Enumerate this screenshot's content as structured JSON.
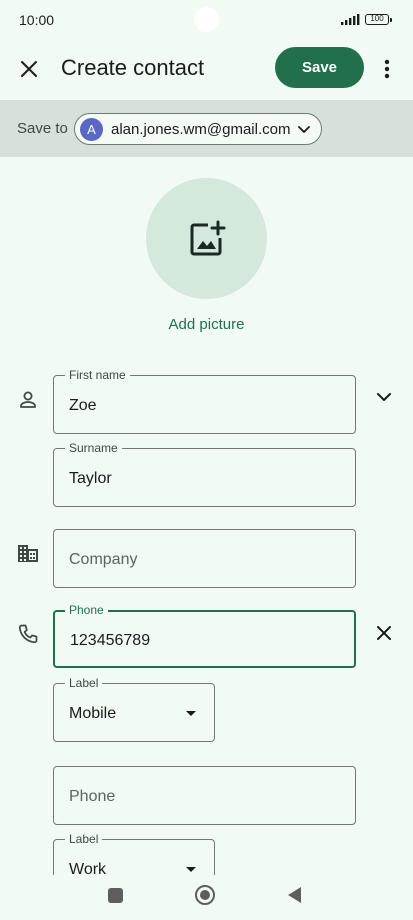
{
  "status": {
    "time": "10:00",
    "battery": "100"
  },
  "header": {
    "title": "Create contact",
    "save_label": "Save"
  },
  "account": {
    "save_to_label": "Save to",
    "avatar_initial": "A",
    "email": "alan.jones.wm@gmail.com"
  },
  "photo": {
    "add_picture_label": "Add picture"
  },
  "form": {
    "first_name": {
      "label": "First name",
      "value": "Zoe"
    },
    "surname": {
      "label": "Surname",
      "value": "Taylor"
    },
    "company": {
      "placeholder": "Company"
    },
    "phone1": {
      "label": "Phone",
      "value": "123456789"
    },
    "phone1_type": {
      "label": "Label",
      "value": "Mobile"
    },
    "phone2": {
      "placeholder": "Phone"
    },
    "phone2_type": {
      "label": "Label",
      "value": "Work"
    }
  },
  "icons": {
    "close": "close-icon",
    "more": "more-vert-icon",
    "person": "person-icon",
    "business": "business-icon",
    "phone": "phone-icon",
    "expand": "chevron-down-icon",
    "add_photo": "add-photo-icon"
  },
  "colors": {
    "accent": "#21704b",
    "background": "#f1faf3",
    "account_bar": "#d6e2d9",
    "photo_circle": "#d4e8dc"
  }
}
